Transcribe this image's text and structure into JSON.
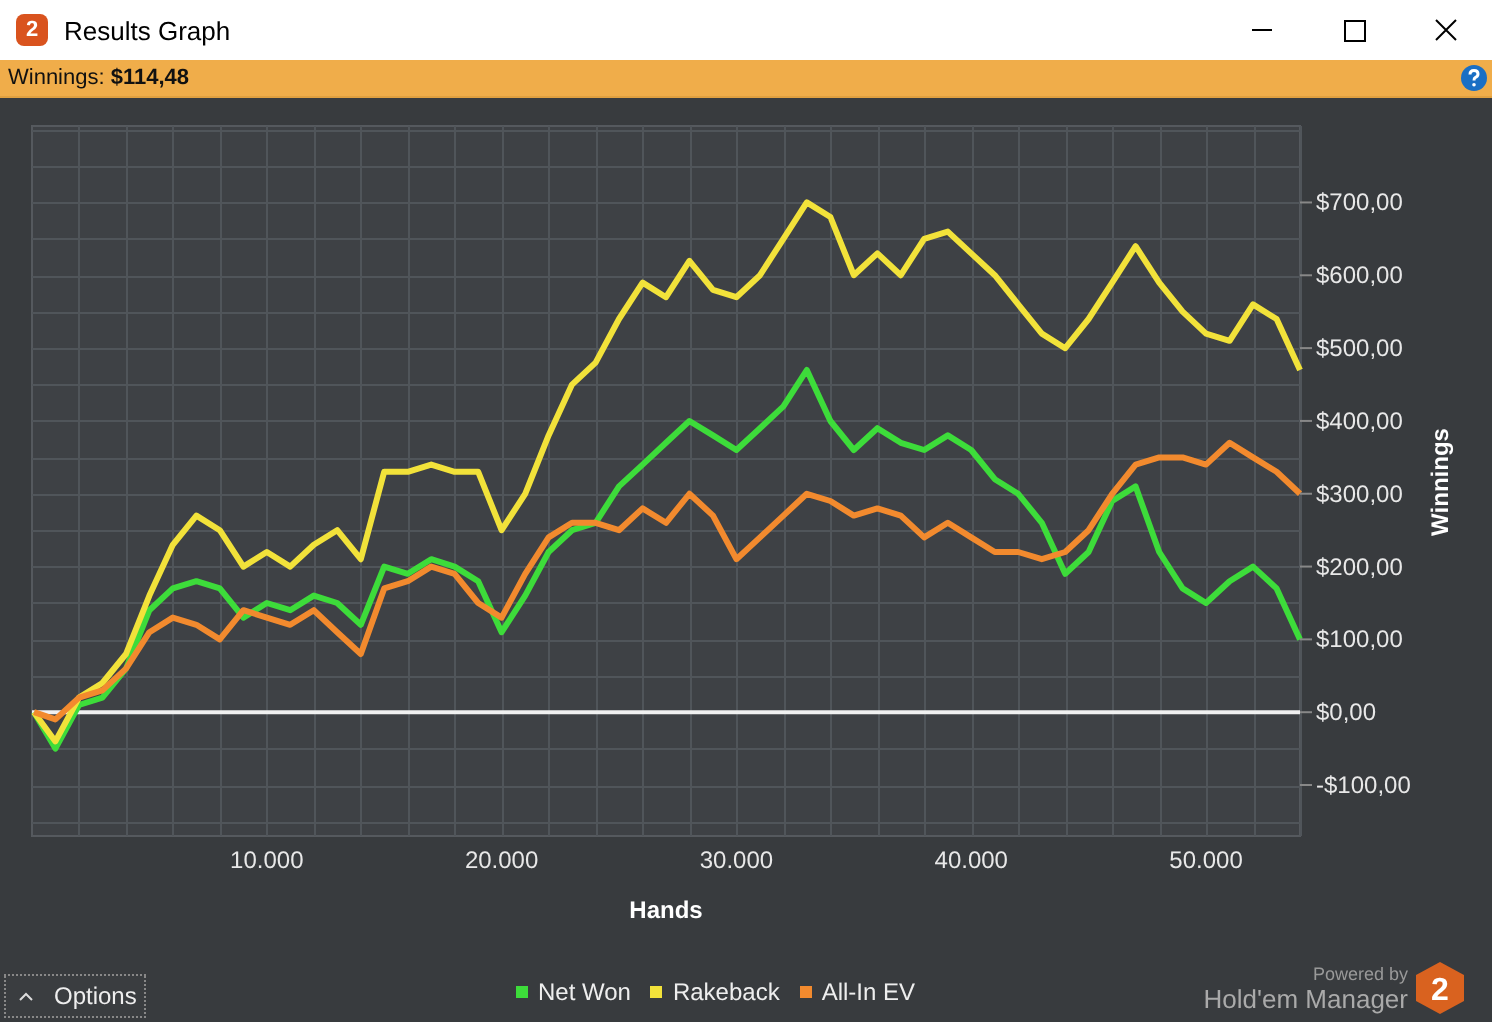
{
  "window": {
    "title": "Results Graph",
    "logo_badge": "2"
  },
  "summary": {
    "label": "Winnings:",
    "value": "$114,48"
  },
  "graph": {
    "chart_data": {
      "type": "line",
      "xlabel": "Hands",
      "ylabel": "Winnings",
      "x": [
        0,
        1000,
        2000,
        3000,
        4000,
        5000,
        6000,
        7000,
        8000,
        9000,
        10000,
        11000,
        12000,
        13000,
        14000,
        15000,
        16000,
        17000,
        18000,
        19000,
        20000,
        21000,
        22000,
        23000,
        24000,
        25000,
        26000,
        27000,
        28000,
        29000,
        30000,
        31000,
        32000,
        33000,
        34000,
        35000,
        36000,
        37000,
        38000,
        39000,
        40000,
        41000,
        42000,
        43000,
        44000,
        45000,
        46000,
        47000,
        48000,
        49000,
        50000,
        51000,
        52000,
        53000,
        54000
      ],
      "xlim": [
        0,
        54000
      ],
      "ylim": [
        -170,
        805
      ],
      "grid": true,
      "xticks": [
        {
          "value": 10000,
          "label": "10.000"
        },
        {
          "value": 20000,
          "label": "20.000"
        },
        {
          "value": 30000,
          "label": "30.000"
        },
        {
          "value": 40000,
          "label": "40.000"
        },
        {
          "value": 50000,
          "label": "50.000"
        }
      ],
      "yticks": [
        {
          "value": -100,
          "label": "-$100,00"
        },
        {
          "value": 0,
          "label": "$0,00"
        },
        {
          "value": 100,
          "label": "$100,00"
        },
        {
          "value": 200,
          "label": "$200,00"
        },
        {
          "value": 300,
          "label": "$300,00"
        },
        {
          "value": 400,
          "label": "$400,00"
        },
        {
          "value": 500,
          "label": "$500,00"
        },
        {
          "value": 600,
          "label": "$600,00"
        },
        {
          "value": 700,
          "label": "$700,00"
        }
      ],
      "series": [
        {
          "name": "Net Won",
          "color": "#3ddc3a",
          "values": [
            0,
            -50,
            10,
            20,
            60,
            140,
            170,
            180,
            170,
            130,
            150,
            140,
            160,
            150,
            120,
            200,
            190,
            210,
            200,
            180,
            110,
            160,
            220,
            250,
            260,
            310,
            340,
            370,
            400,
            380,
            360,
            390,
            420,
            470,
            400,
            360,
            390,
            370,
            360,
            380,
            360,
            320,
            300,
            260,
            190,
            220,
            290,
            310,
            220,
            170,
            150,
            180,
            200,
            170,
            100
          ]
        },
        {
          "name": "Rakeback",
          "color": "#f2e23a",
          "values": [
            0,
            -40,
            20,
            40,
            80,
            160,
            230,
            270,
            250,
            200,
            220,
            200,
            230,
            250,
            210,
            330,
            330,
            340,
            330,
            330,
            250,
            300,
            380,
            450,
            480,
            540,
            590,
            570,
            620,
            580,
            570,
            600,
            650,
            700,
            680,
            600,
            630,
            600,
            650,
            660,
            630,
            600,
            560,
            520,
            500,
            540,
            590,
            640,
            590,
            550,
            520,
            510,
            560,
            540,
            470
          ]
        },
        {
          "name": "All-In EV",
          "color": "#f28a2e",
          "values": [
            0,
            -10,
            20,
            30,
            60,
            110,
            130,
            120,
            100,
            140,
            130,
            120,
            140,
            110,
            80,
            170,
            180,
            200,
            190,
            150,
            130,
            190,
            240,
            260,
            260,
            250,
            280,
            260,
            300,
            270,
            210,
            240,
            270,
            300,
            290,
            270,
            280,
            270,
            240,
            260,
            240,
            220,
            220,
            210,
            220,
            250,
            300,
            340,
            350,
            350,
            340,
            370,
            350,
            330,
            300
          ]
        }
      ]
    }
  },
  "options_button": {
    "label": "Options"
  },
  "branding": {
    "powered_by": "Powered by",
    "product": "Hold'em Manager",
    "badge": "2"
  }
}
